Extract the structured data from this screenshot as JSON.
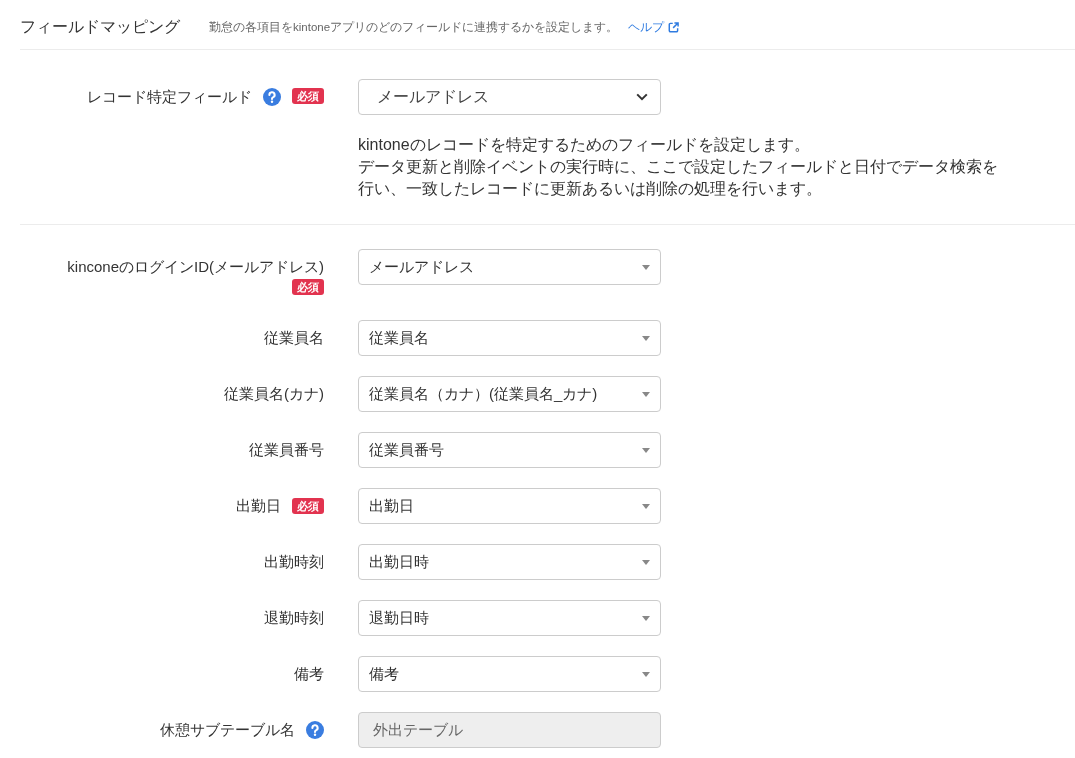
{
  "header": {
    "title": "フィールドマッピング",
    "description": "勤怠の各項目をkintoneアプリのどのフィールドに連携するかを設定します。",
    "help_link": "ヘルプ"
  },
  "record_key": {
    "label": "レコード特定フィールド",
    "help": true,
    "badge": "必須",
    "value": "メールアドレス",
    "note": [
      "kintoneのレコードを特定するためのフィールドを設定します。",
      "データ更新と削除イベントの実行時に、ここで設定したフィールドと日付でデータ検索を行い、一致したレコードに更新あるいは削除の処理を行います。"
    ]
  },
  "mappings": [
    {
      "label": "kinconeのログインID(メールアドレス)",
      "help": false,
      "badge": "必須",
      "kind": "select",
      "value": "メールアドレス",
      "disabled": false
    },
    {
      "label": "従業員名",
      "help": false,
      "kind": "select",
      "value": "従業員名",
      "disabled": false
    },
    {
      "label": "従業員名(カナ)",
      "help": false,
      "kind": "select",
      "value": "従業員名（カナ）(従業員名_カナ)",
      "disabled": false
    },
    {
      "label": "従業員番号",
      "help": false,
      "kind": "select",
      "value": "従業員番号",
      "disabled": false
    },
    {
      "label": "出勤日",
      "help": false,
      "badge": "必須",
      "kind": "select",
      "value": "出勤日",
      "disabled": false
    },
    {
      "label": "出勤時刻",
      "help": false,
      "kind": "select",
      "value": "出勤日時",
      "disabled": false
    },
    {
      "label": "退勤時刻",
      "help": false,
      "kind": "select",
      "value": "退勤日時",
      "disabled": false
    },
    {
      "label": "備考",
      "help": false,
      "kind": "select",
      "value": "備考",
      "disabled": false
    },
    {
      "label": "休憩サブテーブル名",
      "help": true,
      "kind": "text",
      "value": "外出テーブル",
      "disabled": true
    }
  ]
}
